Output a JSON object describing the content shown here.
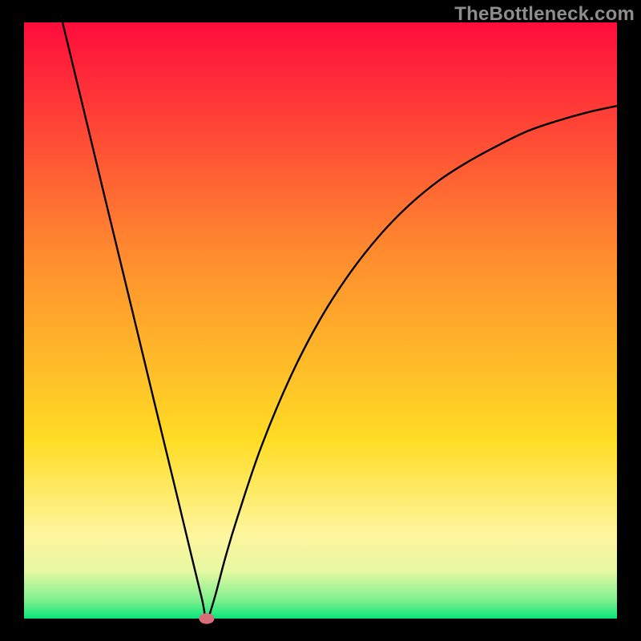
{
  "watermark": "TheBottleneck.com",
  "chart_data": {
    "type": "line",
    "title": "",
    "xlabel": "",
    "ylabel": "",
    "xlim": [
      0,
      100
    ],
    "ylim": [
      0,
      100
    ],
    "background_gradient": {
      "stops": [
        {
          "offset": 0.0,
          "color": "#ff0c3c"
        },
        {
          "offset": 0.4,
          "color": "#ff8f2e"
        },
        {
          "offset": 0.7,
          "color": "#ffdc24"
        },
        {
          "offset": 0.86,
          "color": "#fef69e"
        },
        {
          "offset": 0.92,
          "color": "#e7f8a2"
        },
        {
          "offset": 0.97,
          "color": "#7cf08e"
        },
        {
          "offset": 1.0,
          "color": "#08e47a"
        }
      ]
    },
    "series": [
      {
        "name": "bottleneck-curve",
        "color": "#000000",
        "minimum_x": 30.8,
        "left_top": {
          "x": 6.5,
          "y": 100
        },
        "right_asymptote_y": 86,
        "points": [
          {
            "x": 6.5,
            "y": 100.0
          },
          {
            "x": 10.0,
            "y": 85.6
          },
          {
            "x": 14.0,
            "y": 69.1
          },
          {
            "x": 18.0,
            "y": 52.7
          },
          {
            "x": 22.0,
            "y": 36.2
          },
          {
            "x": 26.0,
            "y": 19.8
          },
          {
            "x": 28.0,
            "y": 11.5
          },
          {
            "x": 30.0,
            "y": 3.3
          },
          {
            "x": 30.8,
            "y": 0.0
          },
          {
            "x": 32.0,
            "y": 3.0
          },
          {
            "x": 34.0,
            "y": 10.4
          },
          {
            "x": 36.0,
            "y": 17.0
          },
          {
            "x": 40.0,
            "y": 28.8
          },
          {
            "x": 45.0,
            "y": 40.7
          },
          {
            "x": 50.0,
            "y": 50.3
          },
          {
            "x": 55.0,
            "y": 58.0
          },
          {
            "x": 60.0,
            "y": 64.3
          },
          {
            "x": 65.0,
            "y": 69.4
          },
          {
            "x": 70.0,
            "y": 73.5
          },
          {
            "x": 75.0,
            "y": 76.7
          },
          {
            "x": 80.0,
            "y": 79.4
          },
          {
            "x": 85.0,
            "y": 81.8
          },
          {
            "x": 90.0,
            "y": 83.5
          },
          {
            "x": 95.0,
            "y": 84.9
          },
          {
            "x": 100.0,
            "y": 86.0
          }
        ]
      }
    ],
    "marker": {
      "x": 30.8,
      "y": 0,
      "rx": 1.3,
      "ry": 0.9,
      "color": "#d96d78"
    }
  }
}
